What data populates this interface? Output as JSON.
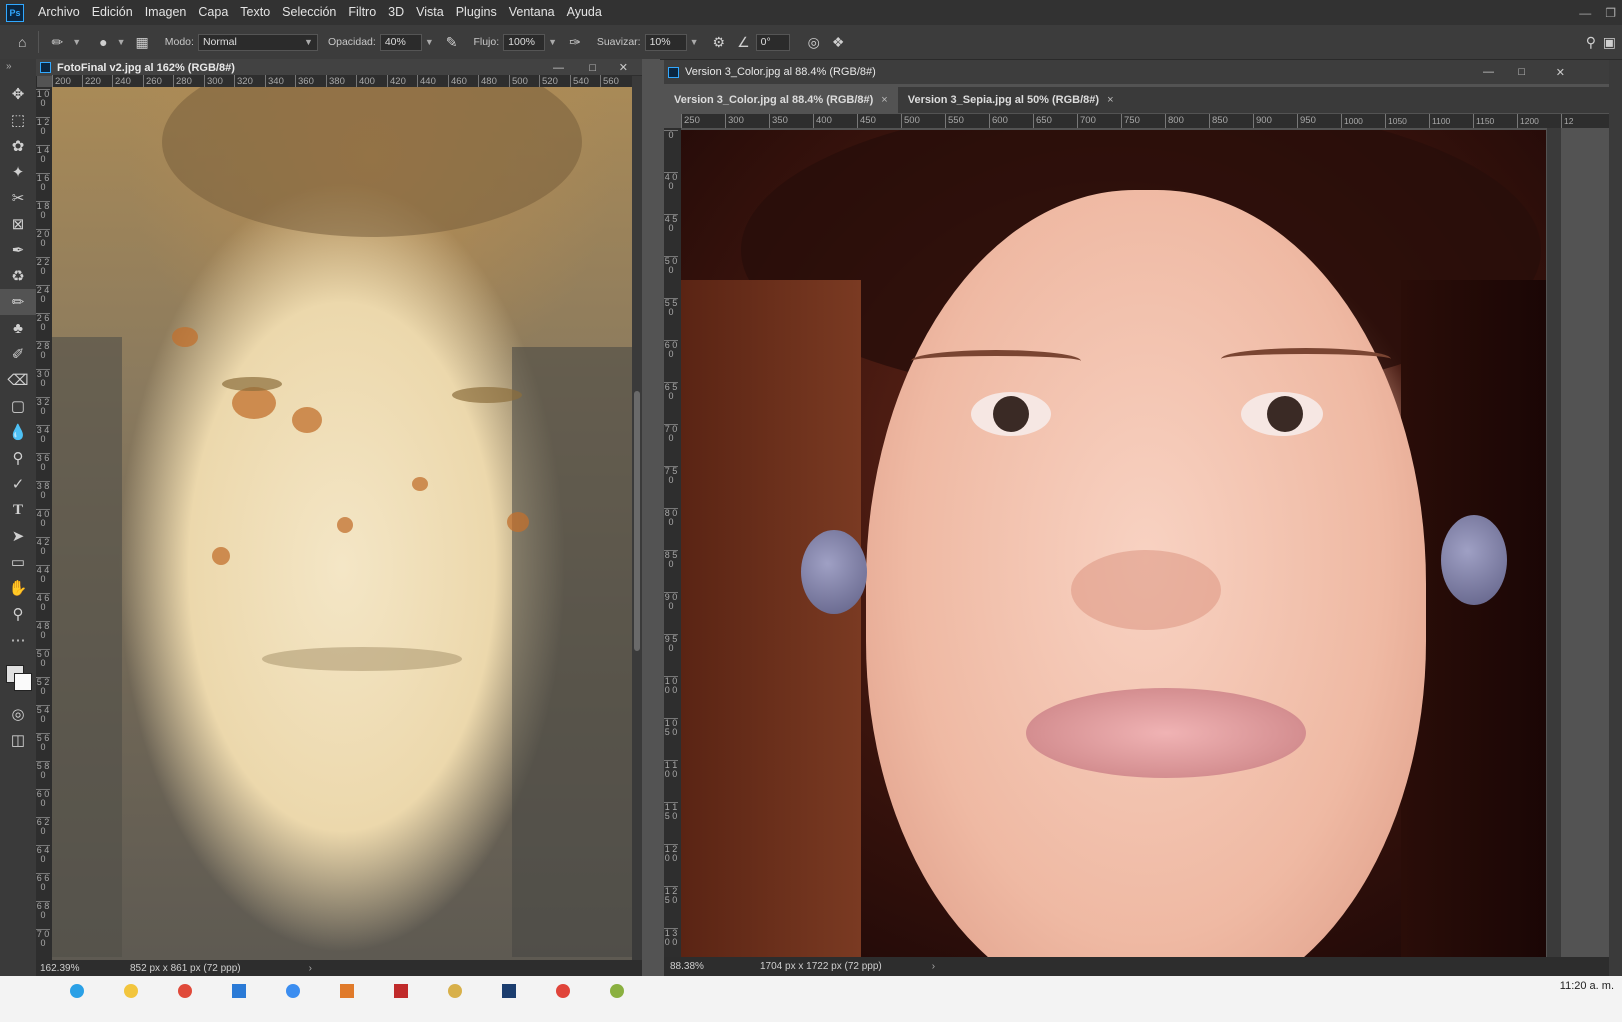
{
  "app": {
    "logo": "Ps"
  },
  "menu": [
    "Archivo",
    "Edición",
    "Imagen",
    "Capa",
    "Texto",
    "Selección",
    "Filtro",
    "3D",
    "Vista",
    "Plugins",
    "Ventana",
    "Ayuda"
  ],
  "options": {
    "modo_label": "Modo:",
    "modo_value": "Normal",
    "opacidad_label": "Opacidad:",
    "opacidad_value": "40%",
    "flujo_label": "Flujo:",
    "flujo_value": "100%",
    "suavizar_label": "Suavizar:",
    "suavizar_value": "10%",
    "angle_value": "0°"
  },
  "tools": [
    "move-icon",
    "marquee-icon",
    "lasso-icon",
    "magic-wand-icon",
    "crop-icon",
    "frame-icon",
    "eyedropper-icon",
    "healing-icon",
    "brush-icon",
    "stamp-icon",
    "history-brush-icon",
    "eraser-icon",
    "gradient-icon",
    "blur-icon",
    "dodge-icon",
    "pen-icon",
    "type-icon",
    "path-select-icon",
    "rectangle-icon",
    "hand-icon",
    "zoom-icon",
    "more-icon"
  ],
  "doc_left": {
    "title": "FotoFinal v2.jpg al 162% (RGB/8#)",
    "ruler_h": [
      "200",
      "220",
      "240",
      "260",
      "280",
      "300",
      "320",
      "340",
      "360",
      "380",
      "400",
      "420",
      "440",
      "460",
      "480",
      "500",
      "520",
      "540",
      "560"
    ],
    "ruler_v": [
      "1 0 0",
      "1 2 0",
      "1 4 0",
      "1 6 0",
      "1 8 0",
      "2 0 0",
      "2 2 0",
      "2 4 0",
      "2 6 0",
      "2 8 0",
      "3 0 0",
      "3 2 0",
      "3 4 0",
      "3 6 0",
      "3 8 0",
      "4 0 0",
      "4 2 0",
      "4 4 0",
      "4 6 0",
      "4 8 0",
      "5 0 0",
      "5 2 0",
      "5 4 0",
      "5 6 0",
      "5 8 0",
      "6 0 0",
      "6 2 0",
      "6 4 0",
      "6 6 0",
      "6 8 0",
      "7 0 0"
    ],
    "zoom": "162.39%",
    "size": "852 px x 861 px (72 ppp)"
  },
  "doc_right": {
    "title": "Version 3_Color.jpg al 88.4% (RGB/8#)",
    "tabs": [
      "Version 3_Color.jpg al 88.4% (RGB/8#)",
      "Version 3_Sepia.jpg al 50% (RGB/8#)"
    ],
    "ruler_h": [
      "250",
      "300",
      "350",
      "400",
      "450",
      "500",
      "550",
      "600",
      "650",
      "700",
      "750",
      "800",
      "850",
      "900",
      "950",
      "1000",
      "1050",
      "1100",
      "1150",
      "1200",
      "12"
    ],
    "ruler_v": [
      "0",
      "4 0 0",
      "4 5 0",
      "5 0 0",
      "5 5 0",
      "6 0 0",
      "6 5 0",
      "7 0 0",
      "7 5 0",
      "8 0 0",
      "8 5 0",
      "9 0 0",
      "9 5 0",
      "1 0 0 0",
      "1 0 5 0",
      "1 1 0 0",
      "1 1 5 0",
      "1 2 0 0",
      "1 2 5 0",
      "1 3 0 0"
    ],
    "zoom": "88.38%",
    "size": "1704 px x 1722 px (72 ppp)"
  },
  "taskbar": {
    "clock": "11:20 a. m."
  }
}
